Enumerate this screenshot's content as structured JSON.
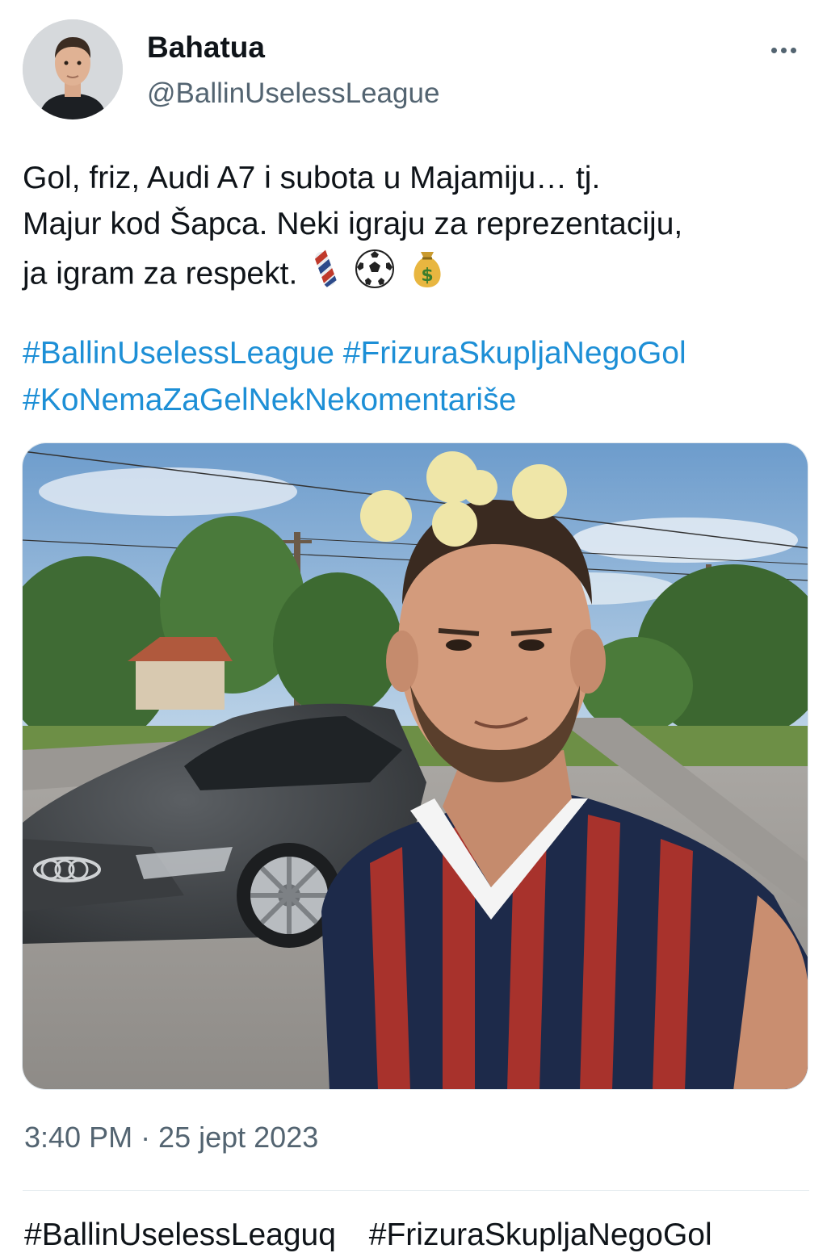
{
  "author": {
    "display_name": "Bahatua",
    "handle": "@BallinUselessLeague",
    "avatar_icon": "profile-photo"
  },
  "tweet": {
    "text_lines": [
      "Gol, friz, Audi A7 i subota u Majamiju… tj.",
      "Majur kod Šapca. Neki igraju za reprezentaciju,",
      "ja igram za respekt."
    ],
    "emojis": [
      "barber-pole-icon",
      "soccer-ball-icon",
      "money-bag-icon"
    ],
    "hashtags": [
      "#BallinUselessLeague",
      "#FrizuraSkupljaNegoGol",
      "#KoNemaZaGelNekNekomentariše"
    ],
    "timestamp": "3:40 PM · 25 jept 2023"
  },
  "bottom_bar": {
    "tags": [
      "#BallinUselessLeaguq",
      "#FrizuraSkupljaNegoGol"
    ]
  },
  "colors": {
    "link": "#1d8fd6",
    "text": "#0f1419",
    "secondary": "#536471"
  }
}
